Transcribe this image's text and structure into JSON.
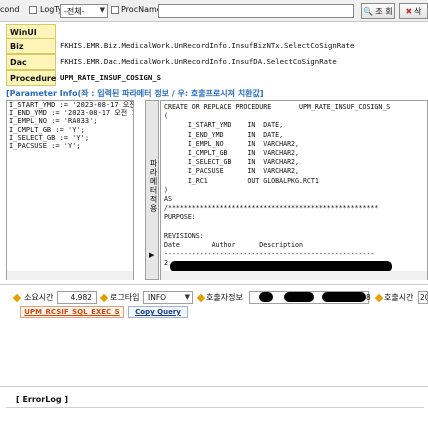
{
  "toolbar": {
    "cond_label": "cond",
    "logtype_label": "LogType",
    "logtype_value": "-전체-",
    "procname_label": "ProcName",
    "procname_value": "",
    "search_label": "조 회",
    "extra_label": "삭"
  },
  "info": {
    "winui_label": "WinUI",
    "winui_value": "",
    "biz_label": "Biz",
    "biz_value": "FKHIS.EMR.Biz.MedicalWork.UnRecordInfo.InsufBizNTx.SelectCoSignRate",
    "dac_label": "Dac",
    "dac_value": "FKHIS.EMR.Dac.MedicalWork.UnRecordInfo.InsufDA.SelectCoSignRate",
    "procedure_label": "Procedure",
    "procedure_value": "UPM_RATE_INSUF_COSIGN_S"
  },
  "param": {
    "header": "[Parameter Info(좌 : 입력된 파라메터 정보 / 우: 호출프로시져 치환값]",
    "lines": [
      "I_START_YMD := '2023-08-17 오전 12",
      "I_END_YMD := '2023-08-17 오전 12:0",
      "I_EMPL_NO := 'RA033';",
      "I_CMPLT_GB := 'Y';",
      "I_SELECT_GB := 'Y';",
      "I_PACSUSE := 'Y';"
    ],
    "apply_label": "파라메터적용",
    "apply_arrow": "▶"
  },
  "sql": {
    "text": "CREATE OR REPLACE PROCEDURE       UPM_RATE_INSUF_COSIGN_S\n(\n      I_START_YMD    IN  DATE,\n      I_END_YMD      IN  DATE,\n      I_EMPL_NO      IN  VARCHAR2,\n      I_CMPLT_GB     IN  VARCHAR2,\n      I_SELECT_GB    IN  VARCHAR2,\n      I_PACSUSE      IN  VARCHAR2,\n      I_RC1          OUT GLOBALPKG.RCT1\n)\nAS\n/*****************************************************\nPURPOSE:\n\nREVISIONS:\nDate        Author      Description\n-----------------------------------------------------\n2"
  },
  "status": {
    "elapsed_label": "소요시간",
    "elapsed_value": "4.982",
    "logtype_label": "로그타입",
    "logtype_value": "INFO",
    "caller_label": "호출자정보",
    "caller_visible_digit": "8",
    "calltime_label": "호출시간",
    "calltime_value": "20"
  },
  "actions": {
    "exec_label": "UPM_RCSIF_SQL_EXEC_S",
    "copy_label": "Copy Query"
  },
  "errorlog": {
    "label": "[ ErrorLog ]"
  },
  "colors": {
    "label_bg": "#fff5b8",
    "header_blue": "#2a6fbf",
    "accent_orange": "#d04a10",
    "diamond": "#e4a000"
  }
}
